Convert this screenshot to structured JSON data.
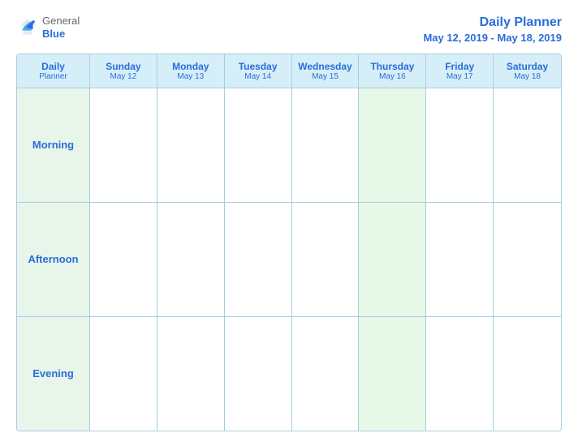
{
  "header": {
    "logo": {
      "general": "General",
      "blue": "Blue",
      "bird_symbol": "🐦"
    },
    "title": "Daily Planner",
    "subtitle": "May 12, 2019 - May 18, 2019"
  },
  "calendar": {
    "header_label_line1": "Daily",
    "header_label_line2": "Planner",
    "columns": [
      {
        "day": "Sunday",
        "date": "May 12"
      },
      {
        "day": "Monday",
        "date": "May 13"
      },
      {
        "day": "Tuesday",
        "date": "May 14"
      },
      {
        "day": "Wednesday",
        "date": "May 15"
      },
      {
        "day": "Thursday",
        "date": "May 16"
      },
      {
        "day": "Friday",
        "date": "May 17"
      },
      {
        "day": "Saturday",
        "date": "May 18"
      }
    ],
    "rows": [
      {
        "label": "Morning"
      },
      {
        "label": "Afternoon"
      },
      {
        "label": "Evening"
      }
    ]
  }
}
